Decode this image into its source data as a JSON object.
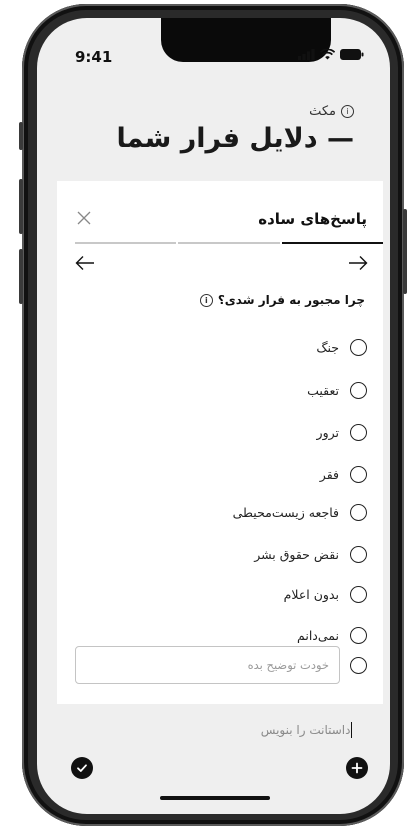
{
  "status_bar": {
    "time": "9:41"
  },
  "header": {
    "subtitle": "مکث",
    "title": "— دلایل فرار شما"
  },
  "card": {
    "title": "پاسخ‌های ساده",
    "progress": {
      "steps": 3,
      "active_step": 1
    },
    "question": "چرا مجبور به فرار شدی؟",
    "options": [
      {
        "label": "جنگ"
      },
      {
        "label": "تعقیب"
      },
      {
        "label": "ترور"
      },
      {
        "label": "فقر"
      },
      {
        "label": "فاجعه زیست‌محیطی"
      },
      {
        "label": "نقض حقوق بشر"
      },
      {
        "label": "بدون اعلام"
      },
      {
        "label": "نمی‌دانم"
      }
    ],
    "other": {
      "placeholder": "خودت توضیح بده",
      "value": ""
    }
  },
  "story": {
    "placeholder": "داستانت را بنویس"
  },
  "icons": {
    "close": "close-icon",
    "next": "arrow-right-icon",
    "prev": "arrow-left-icon",
    "info": "info-icon",
    "check": "check-icon",
    "add": "plus-icon"
  }
}
